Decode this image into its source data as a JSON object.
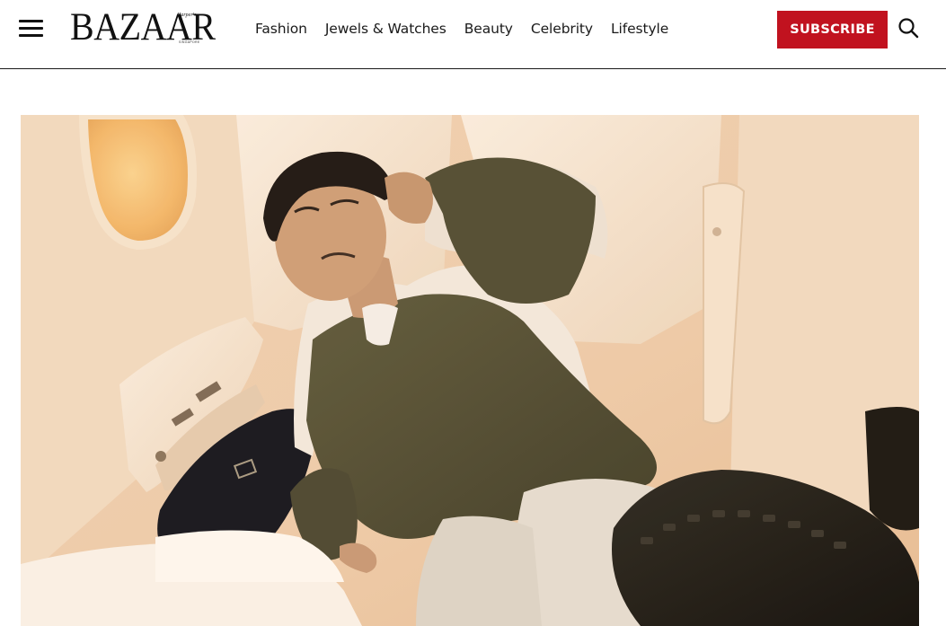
{
  "header": {
    "menu_icon": "hamburger-menu-icon",
    "logo": {
      "main": "BAZAAR",
      "script": "Harper's",
      "region": "SINGAPORE"
    },
    "nav": [
      {
        "label": "Fashion"
      },
      {
        "label": "Jewels & Watches"
      },
      {
        "label": "Beauty"
      },
      {
        "label": "Celebrity"
      },
      {
        "label": "Lifestyle"
      }
    ],
    "subscribe_label": "SUBSCRIBE",
    "search_icon": "search-icon"
  },
  "hero": {
    "image_subject": "man-in-olive-suit-reclining-in-airplane-cabin"
  },
  "colors": {
    "accent": "#c1121f",
    "text": "#111111",
    "divider": "#1a1a1a"
  }
}
